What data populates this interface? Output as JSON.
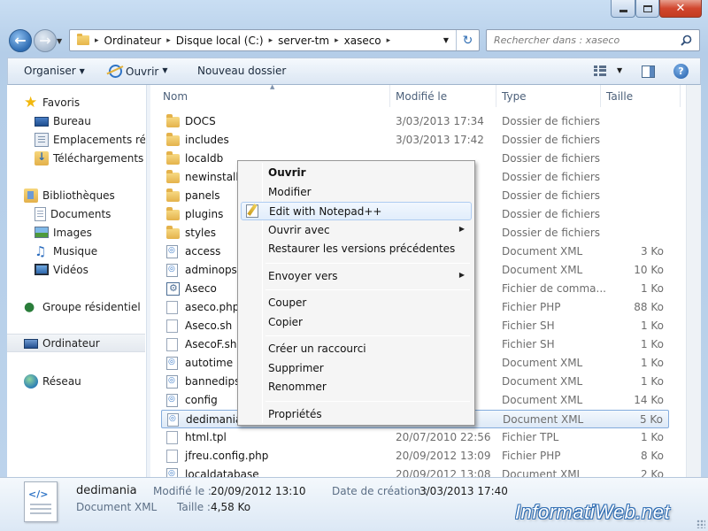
{
  "window": {
    "min_glyph": "",
    "close_glyph": "✕"
  },
  "navigation": {
    "back_arrow": "←",
    "forward_arrow": "→",
    "breadcrumbs": [
      "Ordinateur",
      "Disque local (C:)",
      "server-tm",
      "xaseco"
    ],
    "separator": "▸",
    "refresh_glyph": "↻",
    "search_placeholder": "Rechercher dans : xaseco"
  },
  "toolbar": {
    "organiser": "Organiser",
    "ouvrir": "Ouvrir",
    "nouveau_dossier": "Nouveau dossier",
    "help": "?"
  },
  "sidebar": {
    "items": [
      {
        "label": "Favoris",
        "icon": "star-icon"
      },
      {
        "label": "Bureau",
        "icon": "desktop-icon"
      },
      {
        "label": "Emplacements réce",
        "icon": "recent-places-icon"
      },
      {
        "label": "Téléchargements",
        "icon": "downloads-icon"
      },
      {
        "label": "Bibliothèques",
        "icon": "libraries-icon"
      },
      {
        "label": "Documents",
        "icon": "documents-icon"
      },
      {
        "label": "Images",
        "icon": "pictures-icon"
      },
      {
        "label": "Musique",
        "icon": "music-icon"
      },
      {
        "label": "Vidéos",
        "icon": "videos-icon"
      },
      {
        "label": "Groupe résidentiel",
        "icon": "homegroup-icon"
      },
      {
        "label": "Ordinateur",
        "icon": "computer-icon"
      },
      {
        "label": "Réseau",
        "icon": "network-icon"
      }
    ]
  },
  "columns": {
    "name": "Nom",
    "date": "Modifié le",
    "type": "Type",
    "size": "Taille"
  },
  "files": [
    {
      "name": "DOCS",
      "date": "3/03/2013 17:34",
      "type": "Dossier de fichiers",
      "size": "",
      "icon": "folder-icon"
    },
    {
      "name": "includes",
      "date": "3/03/2013 17:42",
      "type": "Dossier de fichiers",
      "size": "",
      "icon": "folder-icon"
    },
    {
      "name": "localdb",
      "date": "",
      "type": "Dossier de fichiers",
      "size": "",
      "icon": "folder-icon"
    },
    {
      "name": "newinstall",
      "date": "",
      "type": "Dossier de fichiers",
      "size": "",
      "icon": "folder-icon"
    },
    {
      "name": "panels",
      "date": "",
      "type": "Dossier de fichiers",
      "size": "",
      "icon": "folder-icon"
    },
    {
      "name": "plugins",
      "date": "",
      "type": "Dossier de fichiers",
      "size": "",
      "icon": "folder-icon"
    },
    {
      "name": "styles",
      "date": "",
      "type": "Dossier de fichiers",
      "size": "",
      "icon": "folder-icon"
    },
    {
      "name": "access",
      "date": "",
      "type": "Document XML",
      "size": "3 Ko",
      "icon": "xml-file-icon"
    },
    {
      "name": "adminops",
      "date": "",
      "type": "Document XML",
      "size": "10 Ko",
      "icon": "xml-file-icon"
    },
    {
      "name": "Aseco",
      "date": "",
      "type": "Fichier de comma...",
      "size": "1 Ko",
      "icon": "batch-file-icon"
    },
    {
      "name": "aseco.php",
      "date": "",
      "type": "Fichier PHP",
      "size": "88 Ko",
      "icon": "file-icon"
    },
    {
      "name": "Aseco.sh",
      "date": "",
      "type": "Fichier SH",
      "size": "1 Ko",
      "icon": "file-icon"
    },
    {
      "name": "AsecoF.sh",
      "date": "",
      "type": "Fichier SH",
      "size": "1 Ko",
      "icon": "file-icon"
    },
    {
      "name": "autotime",
      "date": "",
      "type": "Document XML",
      "size": "1 Ko",
      "icon": "xml-file-icon"
    },
    {
      "name": "bannedips",
      "date": "",
      "type": "Document XML",
      "size": "1 Ko",
      "icon": "xml-file-icon"
    },
    {
      "name": "config",
      "date": "",
      "type": "Document XML",
      "size": "14 Ko",
      "icon": "xml-file-icon"
    },
    {
      "name": "dedimania",
      "date": "",
      "type": "Document XML",
      "size": "5 Ko",
      "icon": "xml-file-icon",
      "selected": true
    },
    {
      "name": "html.tpl",
      "date": "20/07/2010 22:56",
      "type": "Fichier TPL",
      "size": "1 Ko",
      "icon": "file-icon"
    },
    {
      "name": "jfreu.config.php",
      "date": "20/09/2012 13:09",
      "type": "Fichier PHP",
      "size": "8 Ko",
      "icon": "file-icon"
    },
    {
      "name": "localdatabase",
      "date": "20/09/2012 13:08",
      "type": "Document XML",
      "size": "2 Ko",
      "icon": "xml-file-icon"
    }
  ],
  "context_menu": {
    "items": [
      {
        "label": "Ouvrir",
        "bold": true
      },
      {
        "label": "Modifier"
      },
      {
        "label": "Edit with Notepad++",
        "icon": "notepadpp-icon",
        "highlighted": true
      },
      {
        "label": "Ouvrir avec",
        "submenu": true
      },
      {
        "label": "Restaurer les versions précédentes"
      },
      {
        "separator": true
      },
      {
        "label": "Envoyer vers",
        "submenu": true
      },
      {
        "separator": true
      },
      {
        "label": "Couper"
      },
      {
        "label": "Copier"
      },
      {
        "separator": true
      },
      {
        "label": "Créer un raccourci"
      },
      {
        "label": "Supprimer"
      },
      {
        "label": "Renommer"
      },
      {
        "separator": true
      },
      {
        "label": "Propriétés"
      }
    ],
    "submenu_arrow": "▶"
  },
  "details": {
    "name": "dedimania",
    "type": "Document XML",
    "modified_label": "Modifié le :",
    "modified_value": "20/09/2012 13:10",
    "created_label": "Date de création :",
    "created_value": "3/03/2013 17:40",
    "size_label": "Taille :",
    "size_value": "4,58 Ko"
  },
  "watermark": "InformatiWeb.net",
  "colors": {
    "selection_border": "#84acdd",
    "menu_highlight": "#aeccf1",
    "accent": "#2f6db3"
  }
}
